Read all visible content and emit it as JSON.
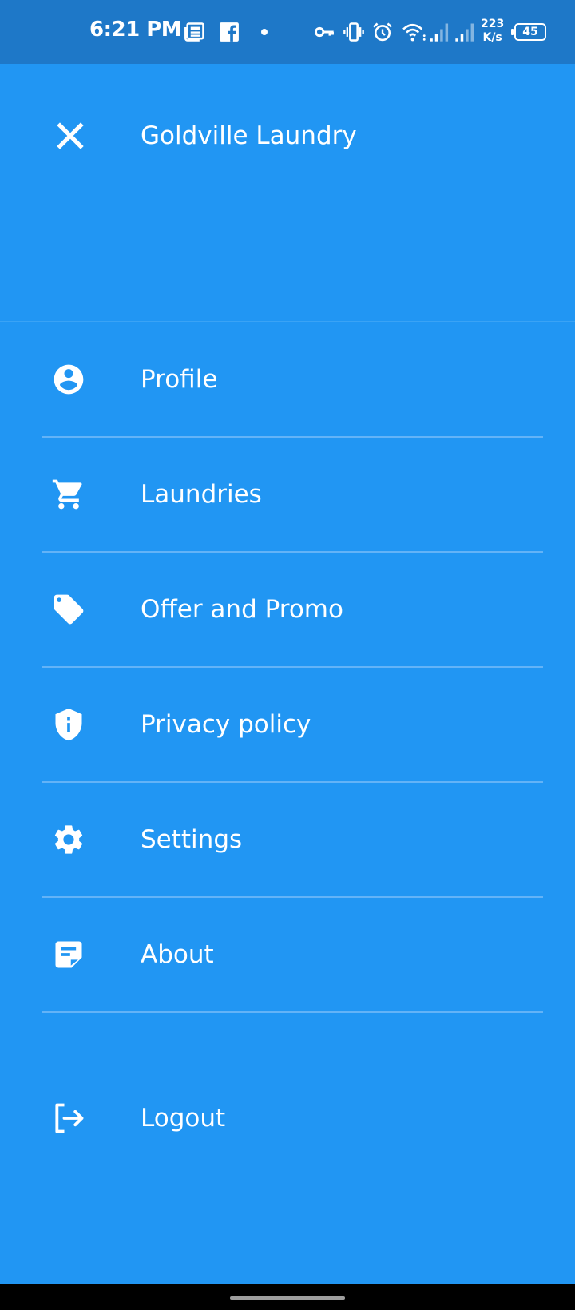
{
  "status_bar": {
    "time": "6:21 PM",
    "net_speed_value": "223",
    "net_speed_unit": "K/s",
    "battery": "45",
    "icons": [
      "news-icon",
      "facebook-icon",
      "dot-icon",
      "vpn-key-icon",
      "vibrate-icon",
      "alarm-icon",
      "wifi-icon",
      "signal-icon",
      "signal-icon",
      "battery-icon"
    ]
  },
  "header": {
    "title": "Goldville Laundry",
    "close_icon": "close-icon"
  },
  "menu": {
    "items": [
      {
        "label": "Profile",
        "icon": "account-circle-icon"
      },
      {
        "label": "Laundries",
        "icon": "shopping-cart-icon"
      },
      {
        "label": "Offer and Promo",
        "icon": "tag-icon"
      },
      {
        "label": "Privacy policy",
        "icon": "shield-info-icon"
      },
      {
        "label": "Settings",
        "icon": "gear-icon"
      },
      {
        "label": "About",
        "icon": "sticky-note-icon"
      }
    ],
    "logout": {
      "label": "Logout",
      "icon": "logout-icon"
    }
  },
  "colors": {
    "drawer_background": "#2196F3",
    "status_bar": "#1E78C8",
    "text": "#FFFFFF",
    "divider": "#63B3F7",
    "nav_bar": "#000000"
  }
}
